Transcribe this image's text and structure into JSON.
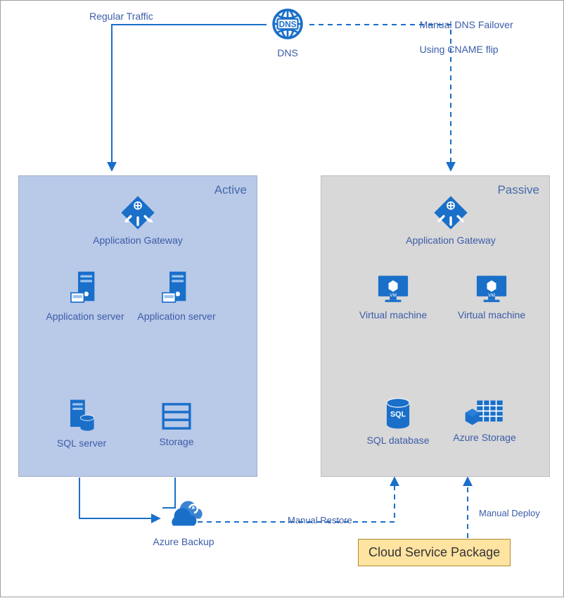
{
  "dns": {
    "label": "DNS"
  },
  "labels": {
    "regular_traffic": "Regular Traffic",
    "failover_line1": "Manual DNS Failover",
    "failover_line2": "Using CNAME flip",
    "manual_restore": "Manual Restore",
    "manual_deploy": "Manual Deploy",
    "azure_backup": "Azure Backup",
    "csp": "Cloud Service Package"
  },
  "regions": {
    "active": {
      "title": "Active",
      "app_gateway": "Application Gateway",
      "app_server1": "Application server",
      "app_server2": "Application server",
      "sql_server": "SQL server",
      "storage": "Storage"
    },
    "passive": {
      "title": "Passive",
      "app_gateway": "Application Gateway",
      "vm1": "Virtual machine",
      "vm2": "Virtual machine",
      "sql_db": "SQL database",
      "azure_storage": "Azure Storage"
    }
  },
  "colors": {
    "azure_blue": "#1a6fc9",
    "text_blue": "#3b5ca8"
  },
  "chart_data": {
    "type": "diagram",
    "title": "Active-Passive disaster recovery architecture with manual failover",
    "nodes": [
      {
        "id": "dns",
        "label": "DNS"
      },
      {
        "id": "active",
        "type": "region",
        "label": "Active"
      },
      {
        "id": "passive",
        "type": "region",
        "label": "Passive"
      },
      {
        "id": "active_appgw",
        "parent": "active",
        "label": "Application Gateway"
      },
      {
        "id": "active_appsrv1",
        "parent": "active",
        "label": "Application server"
      },
      {
        "id": "active_appsrv2",
        "parent": "active",
        "label": "Application server"
      },
      {
        "id": "active_sql",
        "parent": "active",
        "label": "SQL server"
      },
      {
        "id": "active_storage",
        "parent": "active",
        "label": "Storage"
      },
      {
        "id": "passive_appgw",
        "parent": "passive",
        "label": "Application Gateway"
      },
      {
        "id": "passive_vm1",
        "parent": "passive",
        "label": "Virtual machine"
      },
      {
        "id": "passive_vm2",
        "parent": "passive",
        "label": "Virtual machine"
      },
      {
        "id": "passive_sqldb",
        "parent": "passive",
        "label": "SQL database"
      },
      {
        "id": "passive_storage",
        "parent": "passive",
        "label": "Azure Storage"
      },
      {
        "id": "azure_backup",
        "label": "Azure Backup"
      },
      {
        "id": "csp",
        "label": "Cloud Service Package"
      }
    ],
    "edges": [
      {
        "from": "dns",
        "to": "active",
        "label": "Regular Traffic",
        "style": "solid"
      },
      {
        "from": "dns",
        "to": "passive",
        "label": "Manual DNS Failover Using CNAME flip",
        "style": "dashed"
      },
      {
        "from": "active_sql",
        "to": "azure_backup",
        "style": "solid"
      },
      {
        "from": "active_storage",
        "to": "azure_backup",
        "style": "solid"
      },
      {
        "from": "azure_backup",
        "to": "passive_sqldb",
        "label": "Manual Restore",
        "style": "dashed"
      },
      {
        "from": "csp",
        "to": "passive_storage",
        "label": "Manual Deploy",
        "style": "dashed"
      }
    ]
  }
}
